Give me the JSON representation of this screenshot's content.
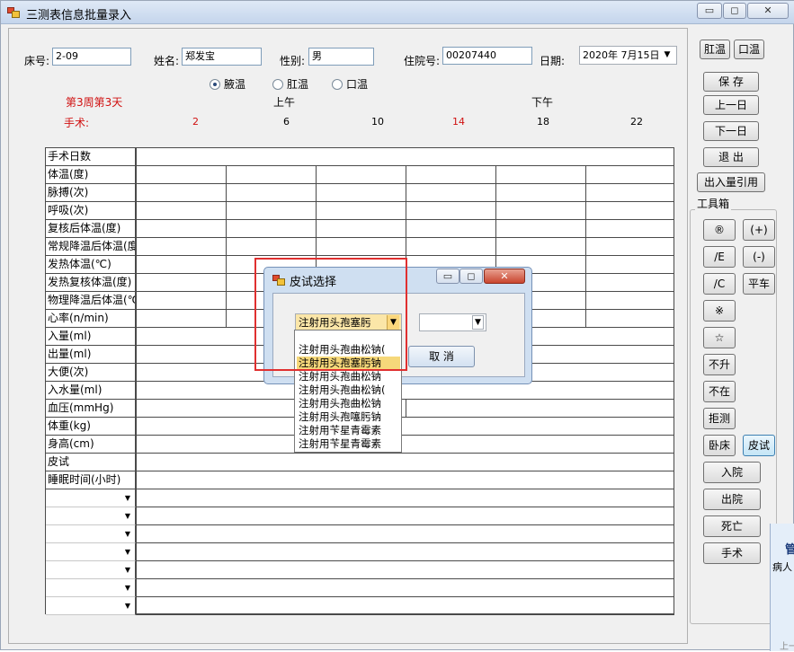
{
  "window": {
    "title": "三测表信息批量录入",
    "min": "▭",
    "max": "◻",
    "close": "✕"
  },
  "patient": {
    "bed_label": "床号:",
    "bed_value": "2-09",
    "name_label": "姓名:",
    "name_value": "郑发宝",
    "sex_label": "性别:",
    "sex_value": "男",
    "admission_label": "住院号:",
    "admission_value": "00207440",
    "date_label": "日期:",
    "date_value": "2020年 7月15日"
  },
  "temp_mode": {
    "options": [
      "腋温",
      "肛温",
      "口温"
    ],
    "selected": "腋温"
  },
  "timeline": {
    "week_day": "第3周第3天",
    "surgery_label": "手术:",
    "am": "上午",
    "pm": "下午",
    "hours": [
      "2",
      "6",
      "10",
      "14",
      "18",
      "22"
    ]
  },
  "rows": [
    "手术日数",
    "体温(度)",
    "脉搏(次)",
    "呼吸(次)",
    "复核后体温(度)",
    "常规降温后体温(度)",
    "发热体温(℃)",
    "发热复核体温(度)",
    "物理降温后体温(℃)",
    "心率(n/min)",
    "入量(ml)",
    "出量(ml)",
    "大便(次)",
    "入水量(ml)",
    "血压(mmHg)",
    "体重(kg)",
    "身高(cm)",
    "皮试",
    "睡眠时间(小时)"
  ],
  "extra_rows": 7,
  "right_buttons": {
    "anal": "肛温",
    "oral": "口温",
    "save": "保 存",
    "prev_day": "上一日",
    "next_day": "下一日",
    "exit": "退 出",
    "io_ref": "出入量引用"
  },
  "toolbox": {
    "label": "工具箱",
    "buttons": [
      "®",
      "(+)",
      "/E",
      "(-)",
      "/C",
      "平车",
      "※",
      "☆",
      "不升",
      "不在",
      "拒测",
      "卧床",
      "皮试",
      "入院",
      "出院",
      "死亡",
      "手术"
    ]
  },
  "dialog": {
    "title": "皮试选择",
    "combo_value": "注射用头孢塞肟",
    "second_combo_value": "",
    "cancel": "取 消",
    "options": [
      "注射用头孢曲松钠(",
      "注射用头孢塞肟钠",
      "注射用头孢曲松钠",
      "注射用头孢曲松钠(",
      "注射用头孢曲松钠",
      "注射用头孢噻肟钠",
      "注射用苄星青霉素",
      "注射用苄星青霉素"
    ],
    "selected_index": 1
  },
  "side_panel": {
    "title": "管",
    "subtitle": "病人",
    "footer": "上一"
  }
}
